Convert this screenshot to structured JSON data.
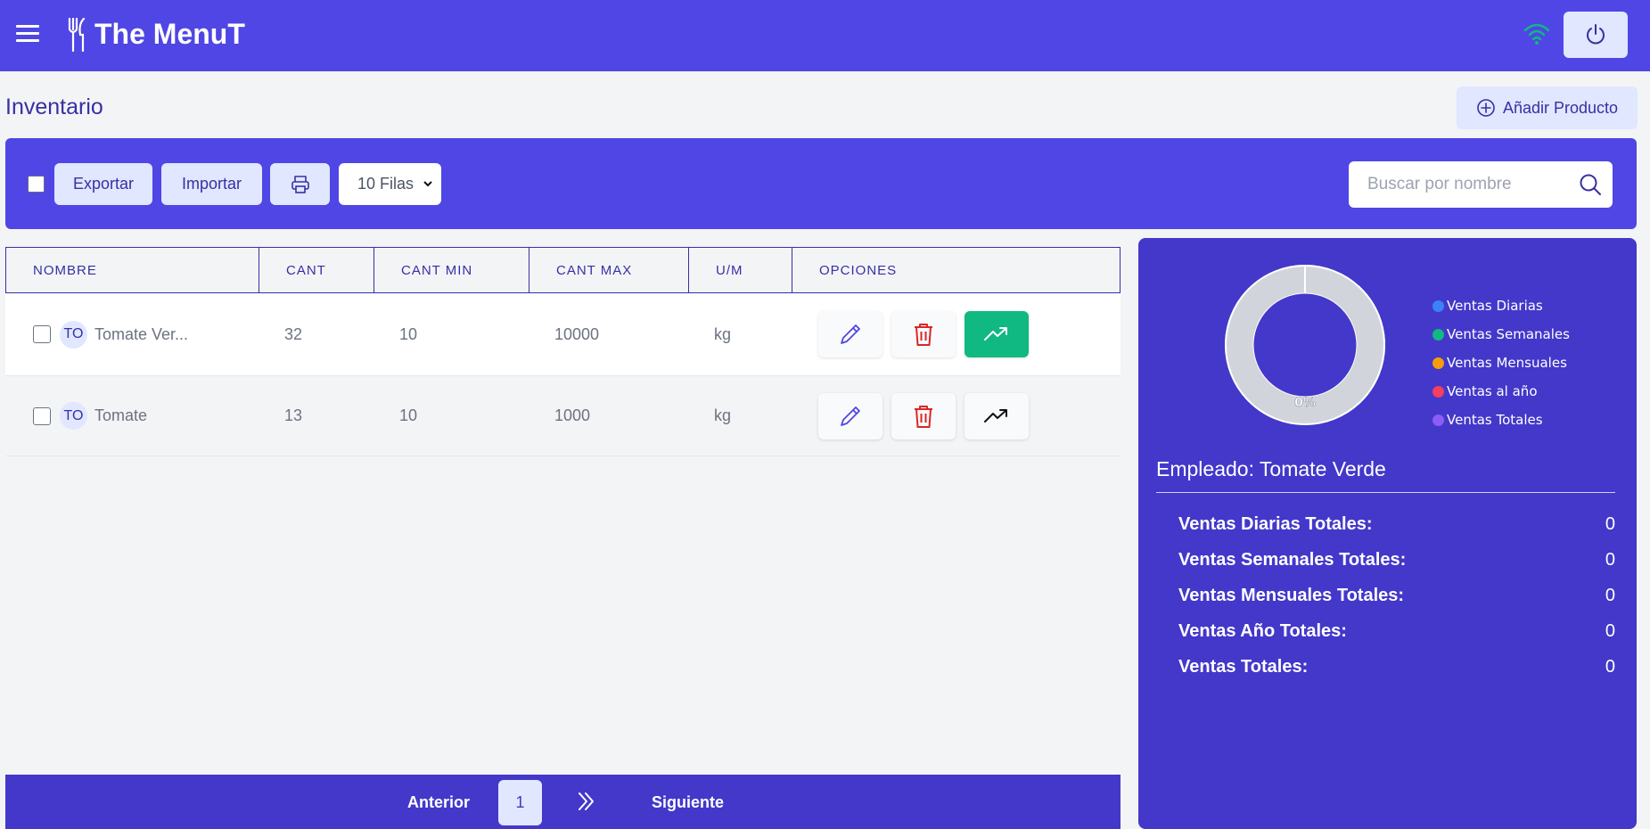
{
  "app": {
    "brand": "The MenuT"
  },
  "page": {
    "title": "Inventario",
    "add_button": "Añadir Producto"
  },
  "toolbar": {
    "export_label": "Exportar",
    "import_label": "Importar",
    "rows_select": "10 Filas",
    "search_placeholder": "Buscar por nombre"
  },
  "table": {
    "headers": [
      "NOMBRE",
      "CANT",
      "CANT MIN",
      "CANT MAX",
      "U/M",
      "OPCIONES"
    ],
    "rows": [
      {
        "avatar": "TO",
        "name": "Tomate Ver...",
        "cant": "32",
        "cant_min": "10",
        "cant_max": "10000",
        "um": "kg"
      },
      {
        "avatar": "TO",
        "name": "Tomate",
        "cant": "13",
        "cant_min": "10",
        "cant_max": "1000",
        "um": "kg"
      }
    ]
  },
  "pagination": {
    "prev": "Anterior",
    "page": "1",
    "next": "Siguiente"
  },
  "panel": {
    "chart_label": "0%",
    "legend": [
      {
        "label": "Ventas Diarias",
        "color": "#3b82f6"
      },
      {
        "label": "Ventas Semanales",
        "color": "#10b981"
      },
      {
        "label": "Ventas Mensuales",
        "color": "#f59e0b"
      },
      {
        "label": "Ventas al año",
        "color": "#f43f5e"
      },
      {
        "label": "Ventas Totales",
        "color": "#8b5cf6"
      }
    ],
    "employee": "Empleado: Tomate Verde",
    "stats": [
      {
        "label": "Ventas Diarias Totales:",
        "value": "0"
      },
      {
        "label": "Ventas Semanales Totales:",
        "value": "0"
      },
      {
        "label": "Ventas Mensuales Totales:",
        "value": "0"
      },
      {
        "label": "Ventas Año Totales:",
        "value": "0"
      },
      {
        "label": "Ventas Totales:",
        "value": "0"
      }
    ]
  },
  "colors": {
    "primary": "#4f46e5",
    "panel": "#4338ca",
    "accent_light": "#e0e7ff",
    "success": "#10b981",
    "danger": "#dc2626"
  }
}
